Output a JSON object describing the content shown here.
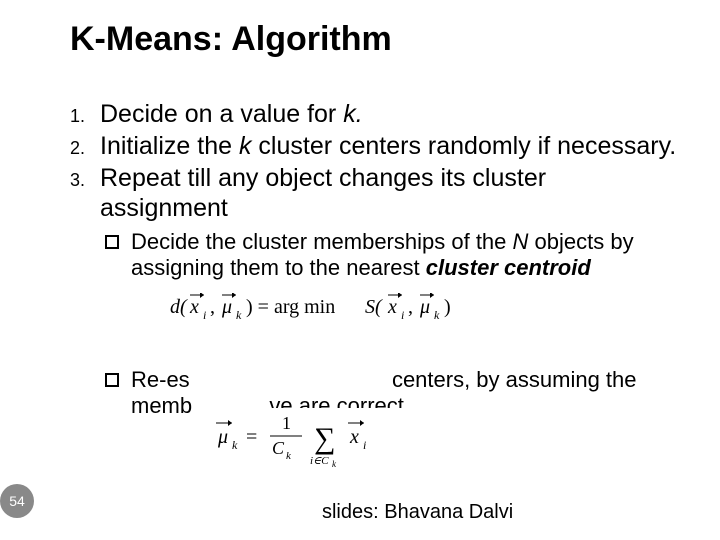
{
  "slide": {
    "title": "K-Means: Algorithm",
    "number": "54",
    "credit": "slides: Bhavana Dalvi"
  },
  "steps": {
    "s1_a": "Decide on a value for ",
    "s1_k": "k.",
    "s2_a": "Initialize the ",
    "s2_k": "k",
    "s2_b": " cluster centers randomly if necessary.",
    "s3": "Repeat till any object changes its cluster assignment"
  },
  "sub": {
    "a1_a": "Decide the cluster memberships of the ",
    "a1_N": "N",
    "a1_b": " objects by assigning them to the nearest ",
    "a1_c": "cluster centroid",
    "b1_a": "Re-es",
    "b1_b": "centers, by assuming the memb",
    "b1_c": "ve are correct."
  },
  "formula": {
    "f1_text": "d(x_i, mu_k) = argmin S(x_i, mu_k)",
    "f2_text": "mu_k = (1/|C_k|) * sum_{i in C_k} x_i"
  }
}
